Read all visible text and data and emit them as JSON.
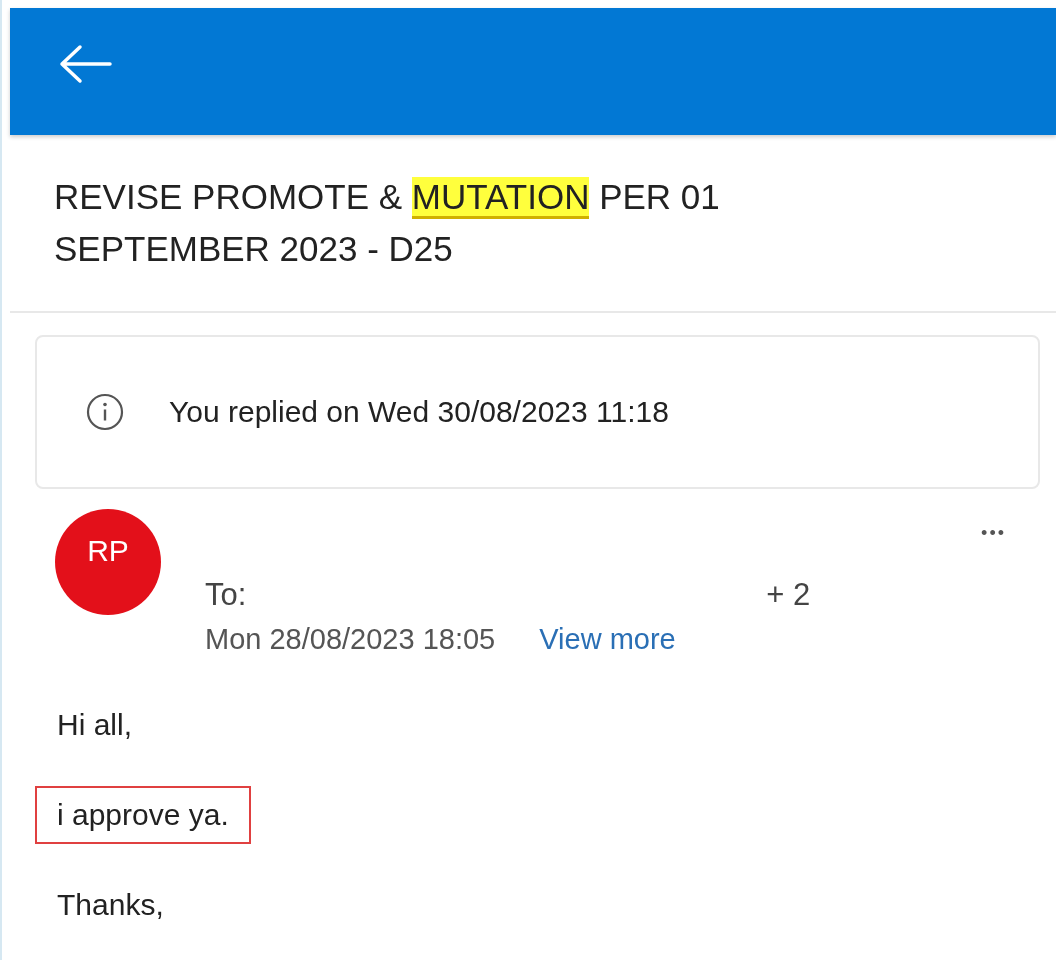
{
  "subject": [
    {
      "text": "REVISE PROMOTE & ",
      "highlighted": false
    },
    {
      "text": "MUTATION",
      "highlighted": true
    },
    {
      "text": " PER 01 SEPTEMBER 2023 - D25",
      "highlighted": false
    }
  ],
  "reply_notice": "You replied on Wed 30/08/2023 11:18",
  "message": {
    "avatar": {
      "initials": "RP",
      "color": "#e3101a"
    },
    "to_label": "To:",
    "extra_recipients": "+ 2",
    "date": "Mon 28/08/2023 18:05",
    "view_more": "View more",
    "more_menu": "•••"
  },
  "body": [
    {
      "text": "Hi all,",
      "boxed": false
    },
    {
      "text": "i approve ya.",
      "boxed": true
    },
    {
      "text": "Thanks,",
      "boxed": false
    }
  ]
}
